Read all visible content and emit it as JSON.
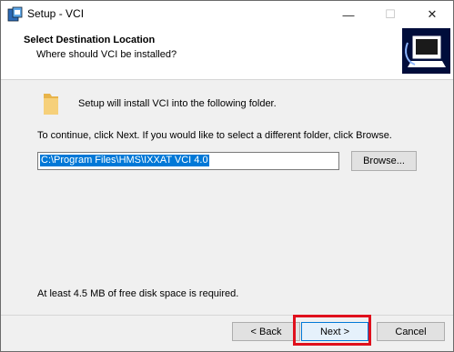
{
  "window": {
    "title": "Setup - VCI",
    "minimize_glyph": "—",
    "maximize_glyph": "☐",
    "close_glyph": "✕"
  },
  "header": {
    "title": "Select Destination Location",
    "subtitle": "Where should VCI be installed?"
  },
  "body": {
    "intro": "Setup will install VCI into the following folder.",
    "continue_text": "To continue, click Next. If you would like to select a different folder, click Browse.",
    "path_value": "C:\\Program Files\\HMS\\IXXAT VCI 4.0",
    "browse_label": "Browse...",
    "space_required": "At least 4.5 MB of free disk space is required."
  },
  "buttons": {
    "back": "< Back",
    "next": "Next >",
    "cancel": "Cancel"
  },
  "colors": {
    "accent": "#0078d7",
    "highlight": "#e0101c",
    "wizard_bg": "#000d3b"
  }
}
